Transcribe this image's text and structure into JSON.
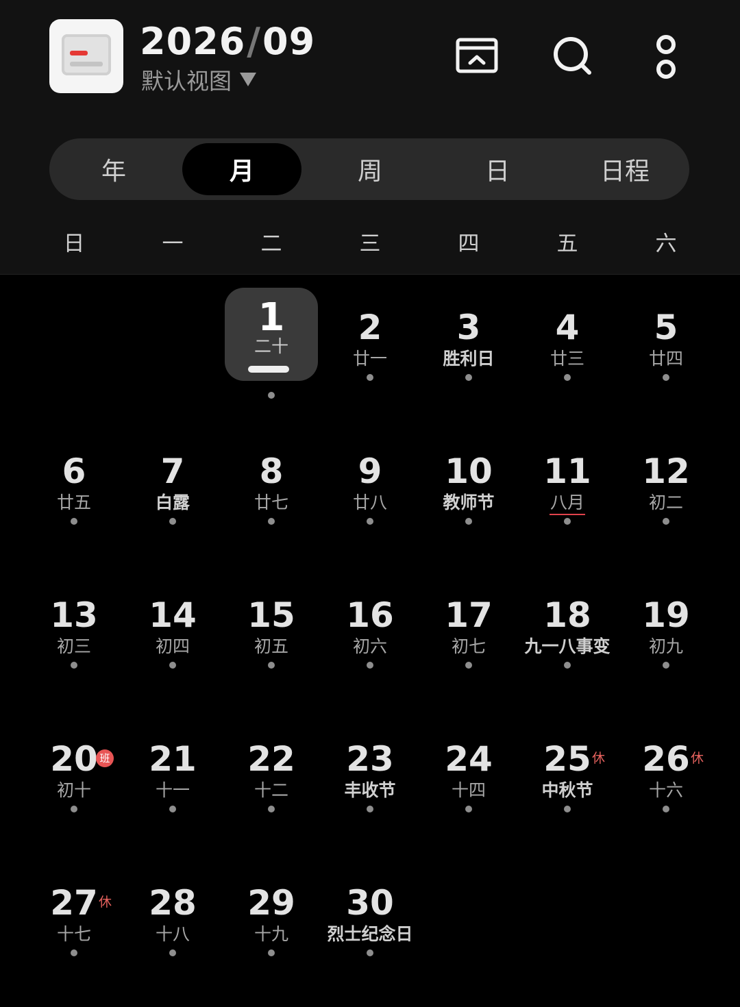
{
  "header": {
    "year": "2026",
    "separator": "/",
    "month": "09",
    "view_label": "默认视图",
    "icons": [
      "collapse-view-icon",
      "search-icon",
      "more-options-icon"
    ]
  },
  "tabs": [
    {
      "label": "年",
      "active": false
    },
    {
      "label": "月",
      "active": true
    },
    {
      "label": "周",
      "active": false
    },
    {
      "label": "日",
      "active": false
    },
    {
      "label": "日程",
      "active": false
    }
  ],
  "weekdays": [
    "日",
    "一",
    "二",
    "三",
    "四",
    "五",
    "六"
  ],
  "colors": {
    "background": "#000000",
    "header_bg": "#121212",
    "accent_red": "#e53935",
    "selected_bg": "#3a3a3a"
  },
  "calendar": {
    "days": [
      {
        "day": "1",
        "sub": "二十",
        "selected": true
      },
      {
        "day": "2",
        "sub": "廿一"
      },
      {
        "day": "3",
        "sub": "胜利日",
        "festival": true
      },
      {
        "day": "4",
        "sub": "廿三"
      },
      {
        "day": "5",
        "sub": "廿四"
      },
      {
        "day": "6",
        "sub": "廿五"
      },
      {
        "day": "7",
        "sub": "白露",
        "festival": true
      },
      {
        "day": "8",
        "sub": "廿七"
      },
      {
        "day": "9",
        "sub": "廿八"
      },
      {
        "day": "10",
        "sub": "教师节",
        "festival": true
      },
      {
        "day": "11",
        "sub": "八月",
        "month_start": true
      },
      {
        "day": "12",
        "sub": "初二"
      },
      {
        "day": "13",
        "sub": "初三"
      },
      {
        "day": "14",
        "sub": "初四"
      },
      {
        "day": "15",
        "sub": "初五"
      },
      {
        "day": "16",
        "sub": "初六"
      },
      {
        "day": "17",
        "sub": "初七"
      },
      {
        "day": "18",
        "sub": "九一八事变",
        "festival": true
      },
      {
        "day": "19",
        "sub": "初九"
      },
      {
        "day": "20",
        "sub": "初十",
        "badge": "班"
      },
      {
        "day": "21",
        "sub": "十一"
      },
      {
        "day": "22",
        "sub": "十二"
      },
      {
        "day": "23",
        "sub": "丰收节",
        "festival": true
      },
      {
        "day": "24",
        "sub": "十四"
      },
      {
        "day": "25",
        "sub": "中秋节",
        "festival": true,
        "badge": "休"
      },
      {
        "day": "26",
        "sub": "十六",
        "badge": "休"
      },
      {
        "day": "27",
        "sub": "十七",
        "badge": "休"
      },
      {
        "day": "28",
        "sub": "十八"
      },
      {
        "day": "29",
        "sub": "十九"
      },
      {
        "day": "30",
        "sub": "烈士纪念日",
        "festival": true
      }
    ]
  }
}
